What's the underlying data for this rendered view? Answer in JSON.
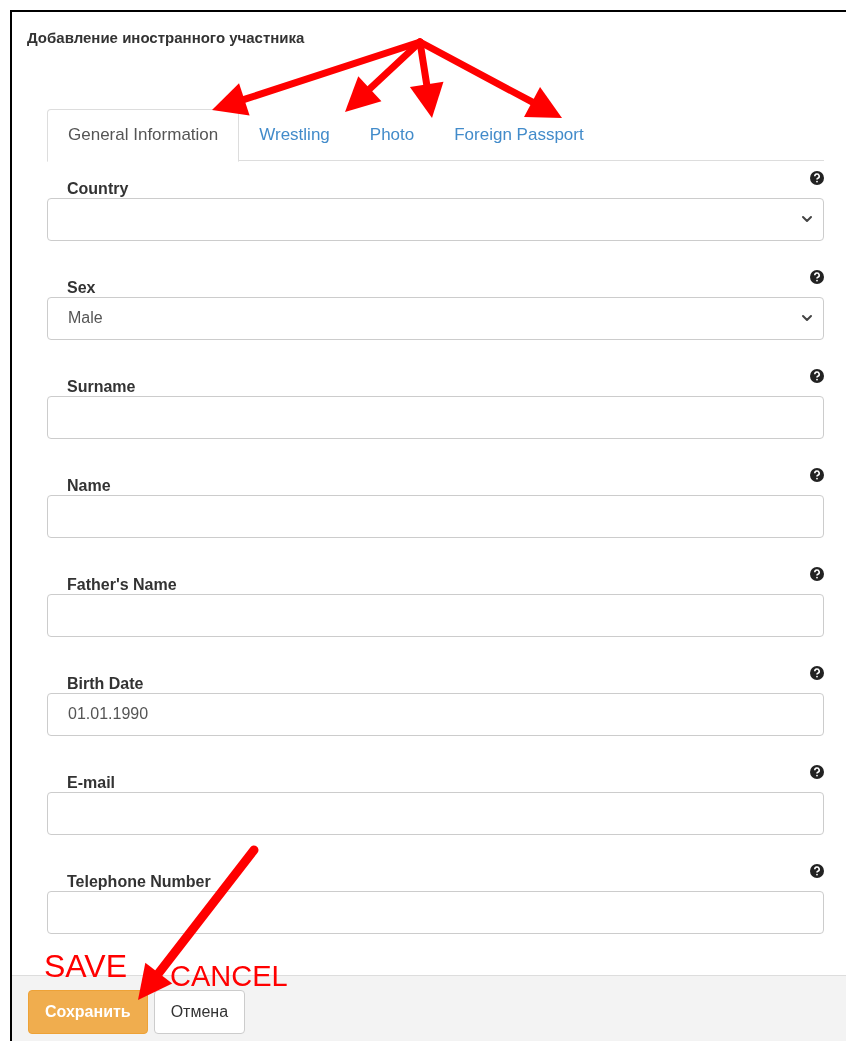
{
  "title": "Добавление иностранного участника",
  "tabs": [
    {
      "label": "General Information",
      "selected": true
    },
    {
      "label": "Wrestling",
      "selected": false
    },
    {
      "label": "Photo",
      "selected": false
    },
    {
      "label": "Foreign Passport",
      "selected": false
    }
  ],
  "fields": [
    {
      "label": "Country",
      "kind": "select"
    },
    {
      "label": "Sex",
      "kind": "select",
      "value": "Male"
    },
    {
      "label": "Surname",
      "kind": "text"
    },
    {
      "label": "Name",
      "kind": "text"
    },
    {
      "label": "Father's Name",
      "kind": "text"
    },
    {
      "label": "Birth Date",
      "kind": "text",
      "value": "01.01.1990"
    },
    {
      "label": "E-mail",
      "kind": "text"
    },
    {
      "label": "Telephone Number",
      "kind": "text"
    }
  ],
  "buttons": [
    {
      "label": "Сохранить",
      "kind": "primary"
    },
    {
      "label": "Отмена",
      "kind": "default"
    }
  ],
  "annotations": [
    "SAVE",
    "CANCEL"
  ]
}
